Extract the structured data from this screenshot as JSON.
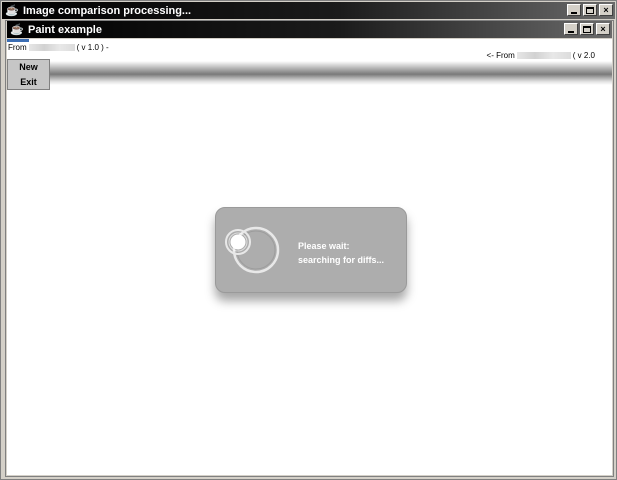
{
  "outer_window": {
    "title": "Image comparison processing...",
    "icon": "java-cup-icon",
    "controls": {
      "minimize": "_",
      "maximize": "□",
      "close": "×"
    }
  },
  "inner_window": {
    "title": "Paint example",
    "icon": "java-cup-icon",
    "controls": {
      "minimize": "_",
      "maximize": "□",
      "close": "×"
    }
  },
  "header": {
    "left_prefix": "From",
    "left_version": "( v 1.0 ) -",
    "right_prefix": "<- From",
    "right_version": "( v 2.0"
  },
  "menu": {
    "items": [
      "New",
      "Exit"
    ]
  },
  "wait_dialog": {
    "line1": "Please wait:",
    "line2": "searching for diffs..."
  },
  "colors": {
    "titlebar": "#000000",
    "dialog_bg": "#adadad",
    "accent": "#3c6eb4"
  }
}
